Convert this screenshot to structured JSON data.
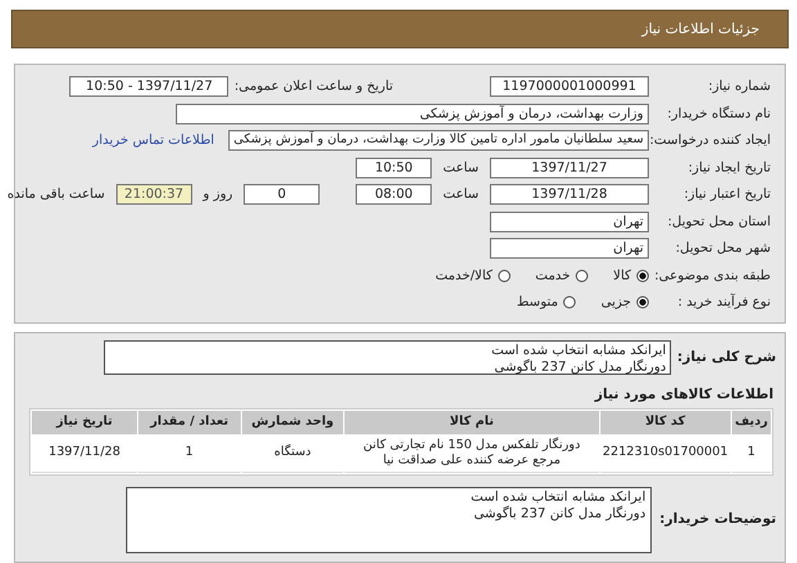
{
  "header": {
    "title": "جزئیات اطلاعات نیاز"
  },
  "details": {
    "need_number": {
      "label": "شماره نیاز:",
      "value": "1197000001000991"
    },
    "announce": {
      "label": "تاریخ و ساعت اعلان عمومی:",
      "value": "1397/11/27 - 10:50"
    },
    "buyer": {
      "label": "نام دستگاه خریدار:",
      "value": "وزارت بهداشت، درمان و آموزش پزشکی"
    },
    "creator": {
      "label": "ایجاد کننده درخواست:",
      "value": "سعید سلطانیان مامور اداره تامین کالا وزارت بهداشت، درمان و آموزش پزشکی",
      "link": "اطلاعات تماس خریدار"
    },
    "created": {
      "label": "تاریخ ایجاد نیاز:",
      "date": "1397/11/27",
      "time_label": "ساعت",
      "time": "10:50"
    },
    "validity": {
      "label": "تاریخ اعتبار نیاز:",
      "date": "1397/11/28",
      "time_label": "ساعت",
      "time": "08:00",
      "days": "0",
      "days_label": "روز و",
      "remaining": "21:00:37",
      "remaining_label": "ساعت باقی مانده"
    },
    "province": {
      "label": "استان محل تحویل:",
      "value": "تهران"
    },
    "city": {
      "label": "شهر محل تحویل:",
      "value": "تهران"
    },
    "category": {
      "label": "طبقه بندی موضوعی:",
      "options": [
        {
          "label": "کالا",
          "selected": true
        },
        {
          "label": "خدمت",
          "selected": false
        },
        {
          "label": "کالا/خدمت",
          "selected": false
        }
      ]
    },
    "process": {
      "label": "نوع فرآیند خرید :",
      "options": [
        {
          "label": "جزیی",
          "selected": true
        },
        {
          "label": "متوسط",
          "selected": false
        }
      ]
    }
  },
  "summary": {
    "label": "شرح کلی نیاز:",
    "lines": [
      "ایرانکد مشابه انتخاب شده است",
      "دورنگار مدل کانن 237 باگوشی"
    ]
  },
  "goods": {
    "title": "اطلاعات کالاهای مورد نیاز",
    "columns": [
      "ردیف",
      "کد کالا",
      "نام کالا",
      "واحد شمارش",
      "تعداد / مقدار",
      "تاریخ نیاز"
    ],
    "rows": [
      [
        "1",
        "2212310s01700001",
        "دورنگار تلفکس مدل 150 نام تجارتی کانن مرجع عرضه کننده علی صداقت نیا",
        "دستگاه",
        "1",
        "1397/11/28"
      ]
    ]
  },
  "notes": {
    "label": "توضیحات خریدار:",
    "lines": [
      "ایرانکد مشابه انتخاب شده است",
      "دورنگار مدل کانن 237 باگوشی"
    ]
  }
}
